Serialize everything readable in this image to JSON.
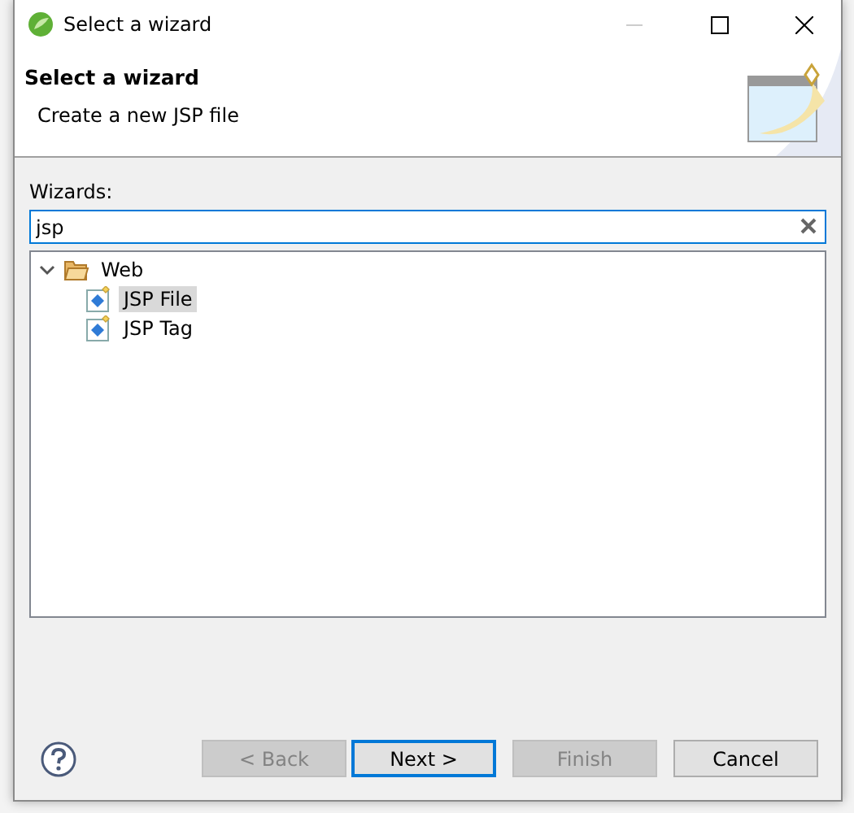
{
  "window": {
    "title": "Select a wizard"
  },
  "header": {
    "title": "Select a wizard",
    "description": "Create a new JSP file"
  },
  "filter": {
    "label": "Wizards:",
    "value": "jsp"
  },
  "tree": [
    {
      "label": "Web",
      "kind": "folder",
      "expanded": true,
      "selected": false,
      "children": [
        {
          "label": "JSP File",
          "kind": "file",
          "selected": true
        },
        {
          "label": "JSP Tag",
          "kind": "file",
          "selected": false
        }
      ]
    }
  ],
  "buttons": [
    {
      "label": "< Back",
      "disabled": true,
      "default": false
    },
    {
      "label": "Next >",
      "disabled": false,
      "default": true
    },
    {
      "label": "Finish",
      "disabled": true,
      "default": false
    },
    {
      "label": "Cancel",
      "disabled": false,
      "default": false
    }
  ]
}
